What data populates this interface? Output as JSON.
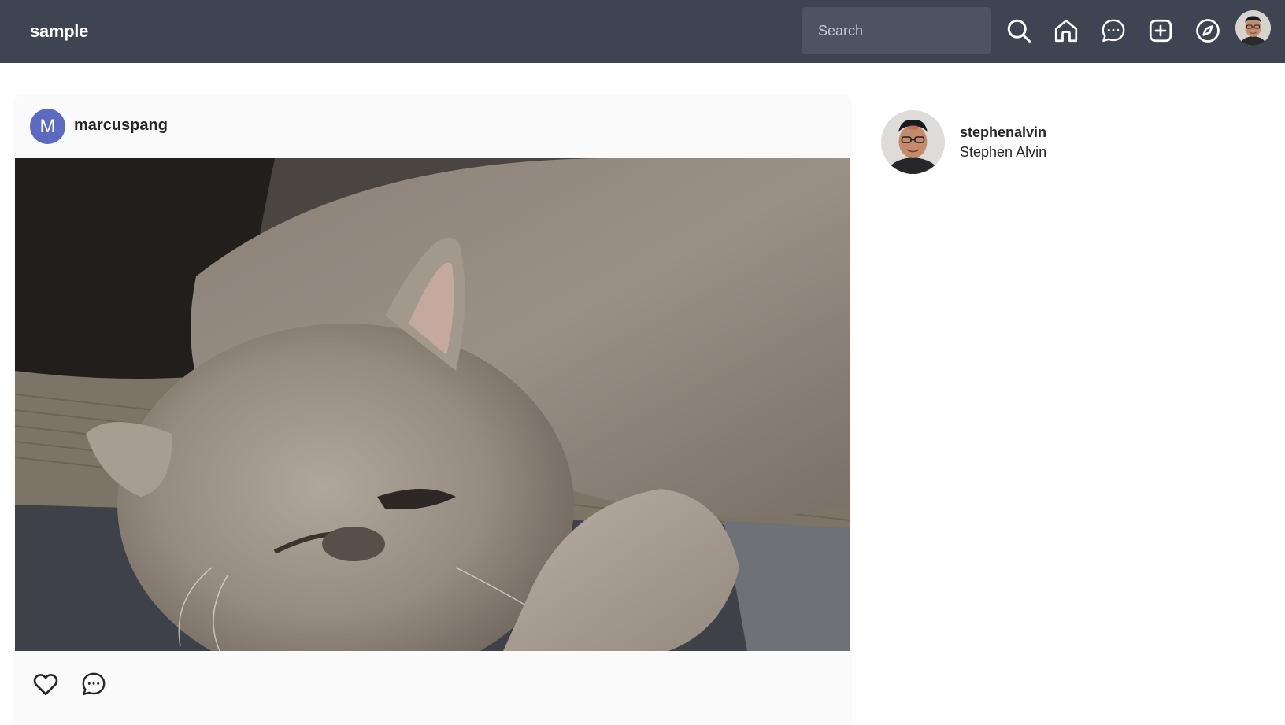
{
  "header": {
    "brand": "sample",
    "search_placeholder": "Search",
    "icons": [
      "search-icon",
      "home-icon",
      "message-icon",
      "add-post-icon",
      "explore-icon"
    ],
    "background_color": "#3e4452"
  },
  "post": {
    "avatar_letter": "M",
    "avatar_color": "#5c6bc0",
    "username": "marcuspang",
    "image_subject": "grey cat",
    "actions": [
      "heart-icon",
      "comment-icon"
    ]
  },
  "sidebar": {
    "username": "stephenalvin",
    "full_name": "Stephen Alvin"
  }
}
